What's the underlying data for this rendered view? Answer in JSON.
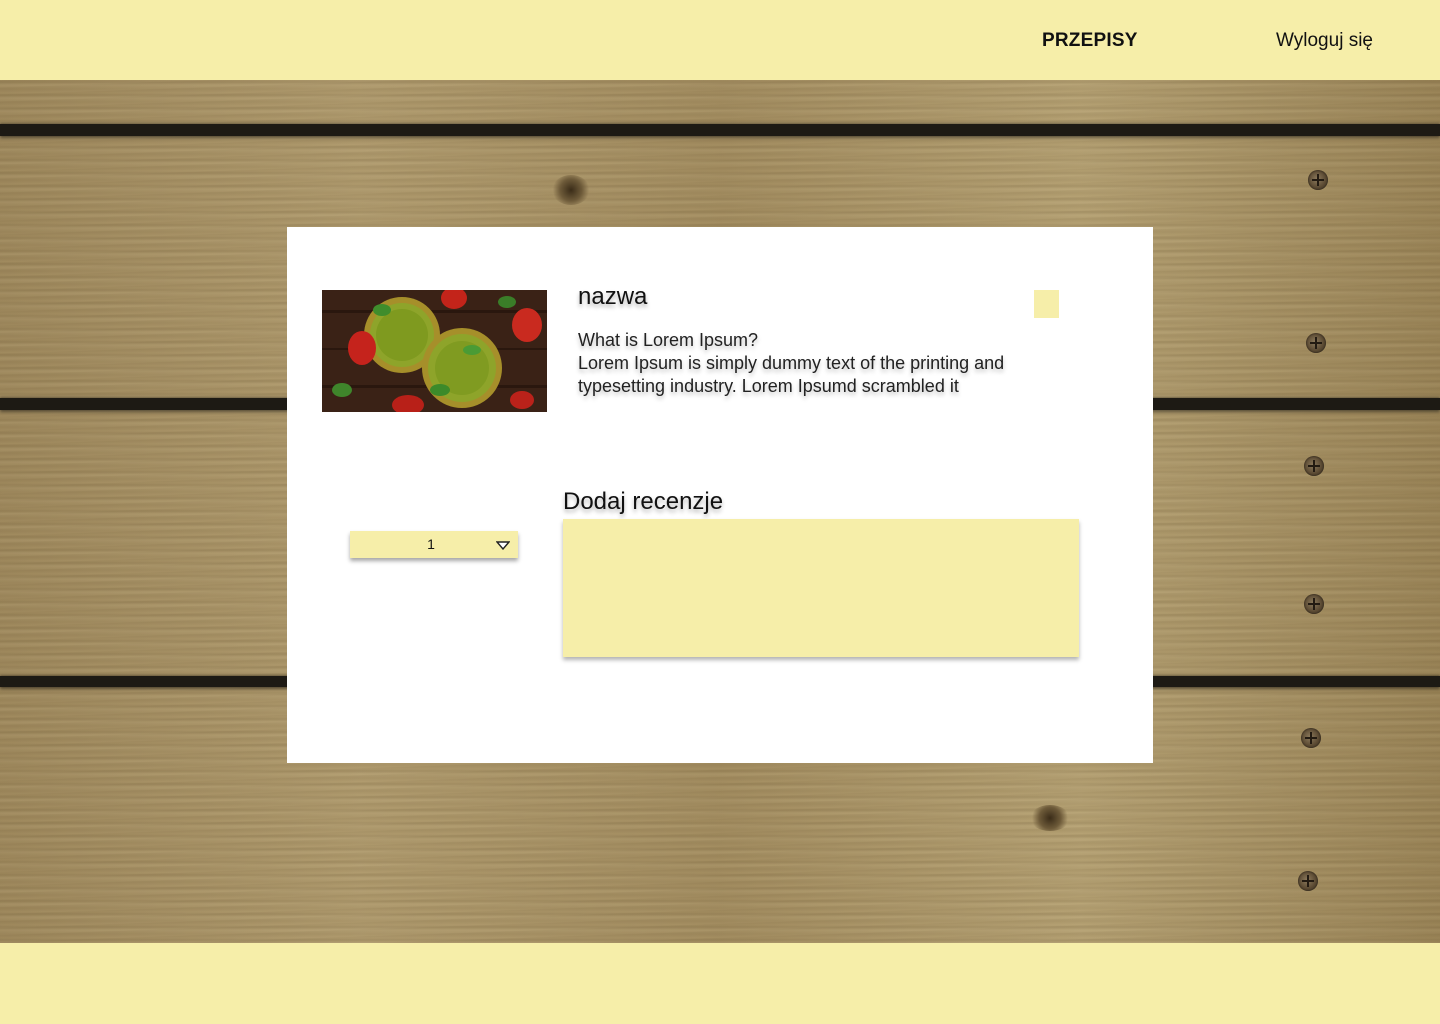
{
  "nav": {
    "recipes_label": "PRZEPISY",
    "logout_label": "Wyloguj się"
  },
  "recipe": {
    "title": "nazwa",
    "description_lines": [
      "What is Lorem Ipsum?",
      "Lorem Ipsum is simply dummy text of the printing and",
      "typesetting industry. Lorem Ipsumd scrambled it"
    ],
    "image_icon": "smoothie-photo"
  },
  "review": {
    "heading": "Dodaj recenzje",
    "text_value": "",
    "rating_selected": "1"
  },
  "colors": {
    "accent": "#f6eea9",
    "card": "#ffffff",
    "text": "#111111"
  }
}
